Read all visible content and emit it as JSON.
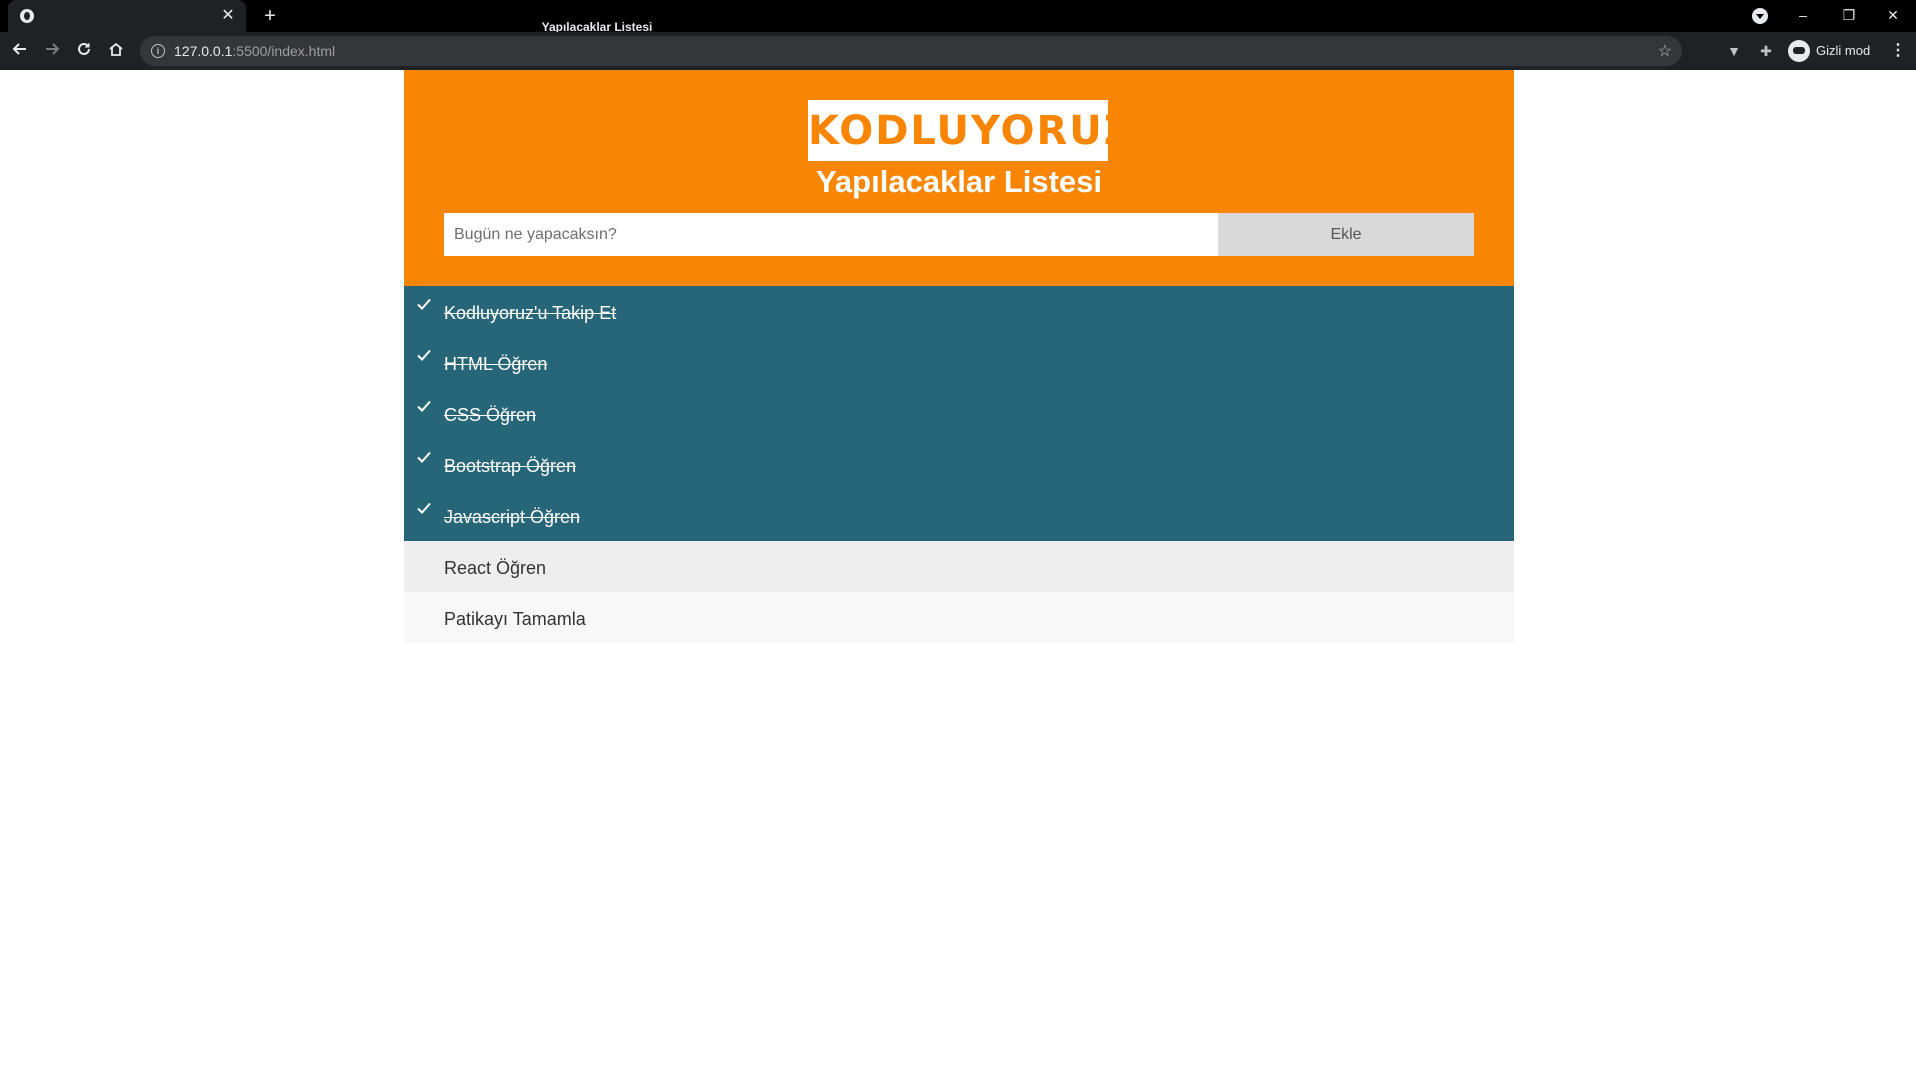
{
  "browser": {
    "tab_title": "Yapılacaklar Listesi",
    "new_tab_glyph": "+",
    "url_host": "127.0.0.1",
    "url_path": ":5500/index.html",
    "profile_label": "Gizli mod"
  },
  "page": {
    "logo_text": "KODLUYORUZ",
    "title": "Yapılacaklar Listesi",
    "input_placeholder": "Bugün ne yapacaksın?",
    "add_button": "Ekle"
  },
  "todos": [
    {
      "text": "Kodluyoruz'u Takip Et",
      "done": true
    },
    {
      "text": "HTML Öğren",
      "done": true
    },
    {
      "text": "CSS Öğren",
      "done": true
    },
    {
      "text": "Bootstrap Öğren",
      "done": true
    },
    {
      "text": "Javascript Öğren",
      "done": true
    },
    {
      "text": "React Öğren",
      "done": false
    },
    {
      "text": "Patikayı Tamamla",
      "done": false
    }
  ],
  "colors": {
    "header_bg": "#f88604",
    "checked_bg": "#276678",
    "unchecked_odd_bg": "#eeeeee",
    "unchecked_even_bg": "#f8f8f8"
  },
  "icons": [
    "globe-icon",
    "close-icon",
    "back-arrow-icon",
    "forward-arrow-icon",
    "reload-icon",
    "home-icon",
    "info-icon",
    "star-icon",
    "checkmark-icon"
  ]
}
